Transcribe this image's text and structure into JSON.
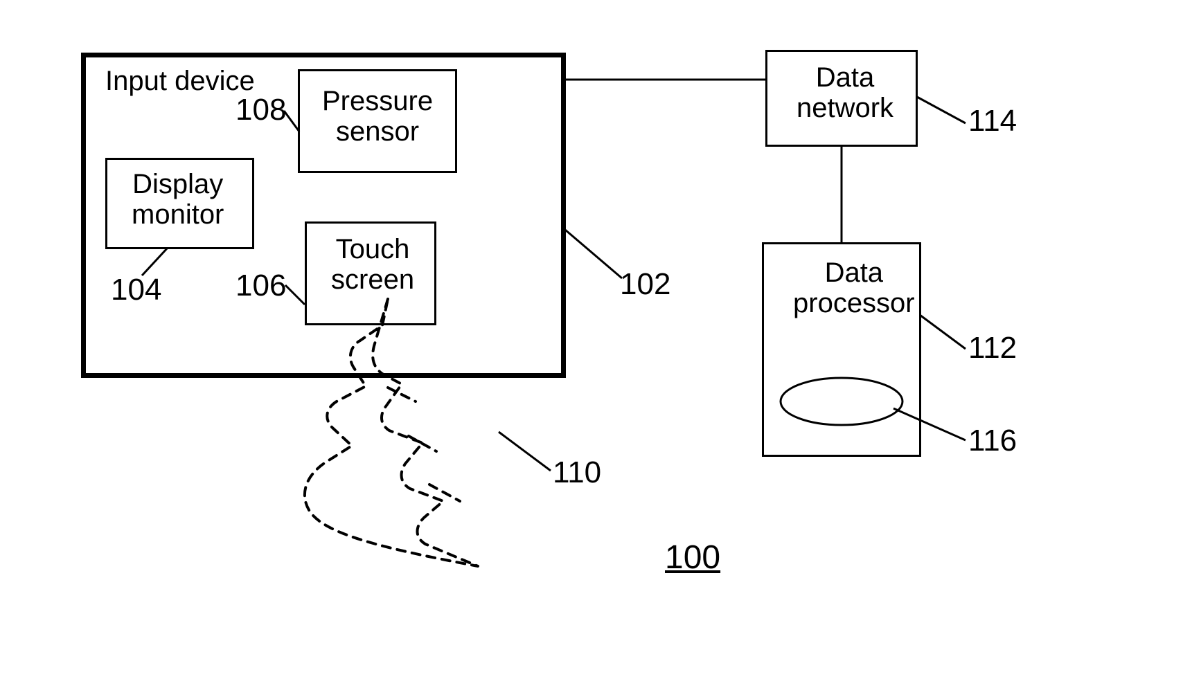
{
  "blocks": {
    "input_device": {
      "title": "Input device"
    },
    "display_monitor": {
      "label": "Display\nmonitor"
    },
    "pressure_sensor": {
      "label": "Pressure\nsensor"
    },
    "touch_screen": {
      "label": "Touch\nscreen"
    },
    "data_network": {
      "label": "Data\nnetwork"
    },
    "data_processor": {
      "label": "Data\nprocessor"
    }
  },
  "refs": {
    "figure": "100",
    "input_device": "102",
    "display_monitor": "104",
    "touch_screen": "106",
    "pressure_sensor": "108",
    "hand": "110",
    "data_processor": "112",
    "data_network": "114",
    "storage": "116"
  }
}
